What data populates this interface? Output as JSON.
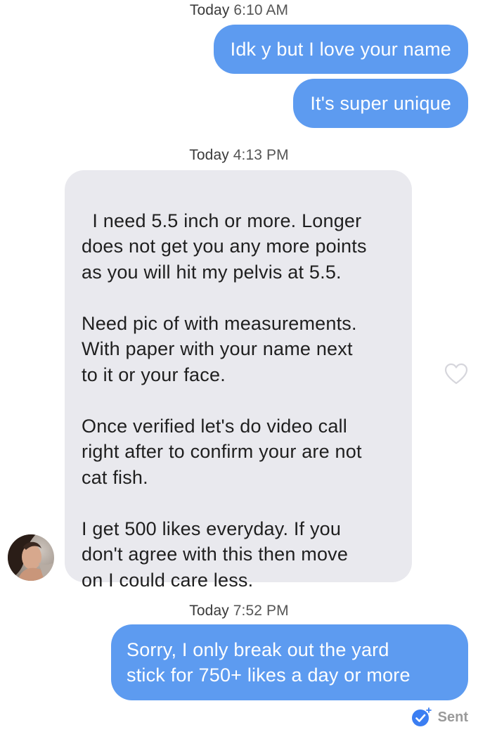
{
  "conversation": {
    "timestamps": [
      {
        "day": "Today",
        "time": "6:10 AM"
      },
      {
        "day": "Today",
        "time": "4:13 PM"
      },
      {
        "day": "Today",
        "time": "7:52 PM"
      }
    ],
    "outgoing_1": "Idk y but I love your name",
    "outgoing_2": "It's super unique",
    "incoming_1": "I need 5.5 inch or more. Longer\ndoes not get you any more points\nas you will hit my pelvis at 5.5.\n\nNeed pic of with measurements.\nWith paper with your name next\nto it or your face.\n\nOnce verified let's do video call\nright after to confirm your are not\ncat fish.\n\nI get 500 likes everyday. If you\ndon't agree with this then move\non I could care less.",
    "outgoing_3_line1": "Sorry, I only break out the yard",
    "outgoing_3_line2": "stick for 750+ likes a day or more",
    "status": "Sent"
  },
  "icons": {
    "like": "heart-outline-icon",
    "read_receipt": "checkmark-badge-icon",
    "avatar": "user-avatar"
  },
  "colors": {
    "outgoing_bubble": "#5d9bf0",
    "incoming_bubble": "#e9e9ee",
    "sent_text": "#9a9a9a"
  }
}
